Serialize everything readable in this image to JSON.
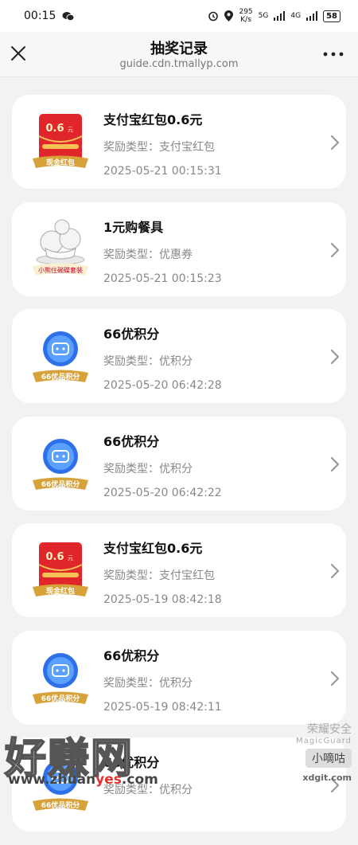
{
  "status_bar": {
    "time": "00:15",
    "speed_value": "295",
    "speed_unit": "K/s",
    "signal1": "5G",
    "signal2": "4G",
    "battery": "58"
  },
  "header": {
    "title": "抽奖记录",
    "url": "guide.cdn.tmallyp.com"
  },
  "type_prefix": "奖励类型：",
  "records": [
    {
      "icon": "red-envelope-icon",
      "title": "支付宝红包0.6元",
      "type": "支付宝红包",
      "time": "2025-05-21 00:15:31",
      "badge": "现金红包",
      "amount": "0.6",
      "unit": "元"
    },
    {
      "icon": "tableware-icon",
      "title": "1元购餐具",
      "type": "优惠券",
      "time": "2025-05-21 00:15:23",
      "badge": "小熊住碗碟套装"
    },
    {
      "icon": "points-coin-icon",
      "title": "66优积分",
      "type": "优积分",
      "time": "2025-05-20 06:42:28",
      "badge": "66优品积分"
    },
    {
      "icon": "points-coin-icon",
      "title": "66优积分",
      "type": "优积分",
      "time": "2025-05-20 06:42:22",
      "badge": "66优品积分"
    },
    {
      "icon": "red-envelope-icon",
      "title": "支付宝红包0.6元",
      "type": "支付宝红包",
      "time": "2025-05-19 08:42:18",
      "badge": "现金红包",
      "amount": "0.6",
      "unit": "元"
    },
    {
      "icon": "points-coin-icon",
      "title": "66优积分",
      "type": "优积分",
      "time": "2025-05-19 08:42:11",
      "badge": "66优品积分"
    },
    {
      "icon": "points-coin-icon",
      "title": "66优积分",
      "type": "优积分",
      "time": "",
      "badge": "66优品积分"
    }
  ],
  "watermarks": {
    "left_big": "好赚网",
    "left_small_a": "www.zhuan",
    "left_small_b": "yes",
    "left_small_c": ".com",
    "right_1": "荣耀安全",
    "right_2": "MagicGuard",
    "right_badge": "小嘀咕",
    "right_3": "xdgit.com"
  },
  "colors": {
    "card_bg": "#ffffff",
    "page_bg": "#f2f2f2",
    "envelope_red": "#e0262b",
    "badge_gold": "#d8a23a",
    "coin_blue": "#3a7bf0"
  }
}
